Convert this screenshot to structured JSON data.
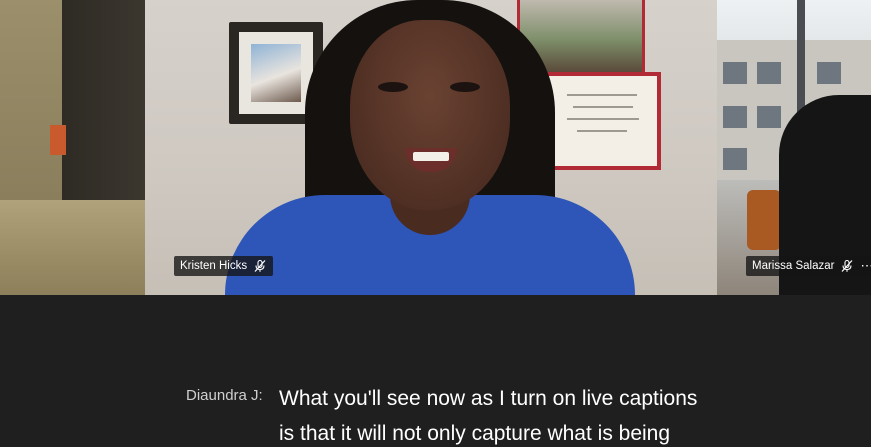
{
  "participants": [
    {
      "name": "Kristen Hicks",
      "mic_icon": "mic-off-icon"
    },
    {
      "name": "Marissa Salazar",
      "mic_icon": "mic-off-icon",
      "more_icon": "more-options-icon"
    }
  ],
  "captions": {
    "speaker": "Diaundra J:",
    "lines": [
      "What you'll see now as I turn on live captions",
      "is that it will not only capture what is being"
    ]
  },
  "colors": {
    "background": "#1f1f1f",
    "caption_text": "#ffffff",
    "speaker_text": "#cfcfcf",
    "name_tag_bg": "#141414"
  }
}
